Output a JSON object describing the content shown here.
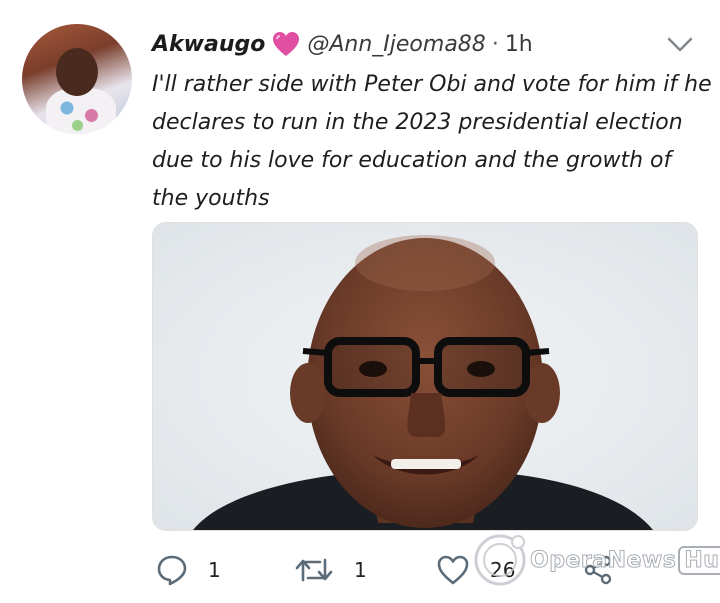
{
  "tweet": {
    "author_name": "Akwaugo",
    "handle": "@Ann_Ijeoma88",
    "separator": "·",
    "time": "1h",
    "text": "I'll rather side with Peter Obi and vote for him if he declares to run in the 2023 presidential election due to his love for education and the growth of the youths"
  },
  "actions": {
    "reply_count": "1",
    "retweet_count": "1",
    "like_count": "26"
  },
  "watermark": {
    "text": "OperaNews",
    "hub": "Hub"
  },
  "colors": {
    "heart": "#e04fa2",
    "icon": "#5b6b78",
    "text": "#1c1c1c"
  },
  "icons": [
    "chevron-down-icon",
    "reply-icon",
    "retweet-icon",
    "like-icon",
    "share-icon"
  ]
}
